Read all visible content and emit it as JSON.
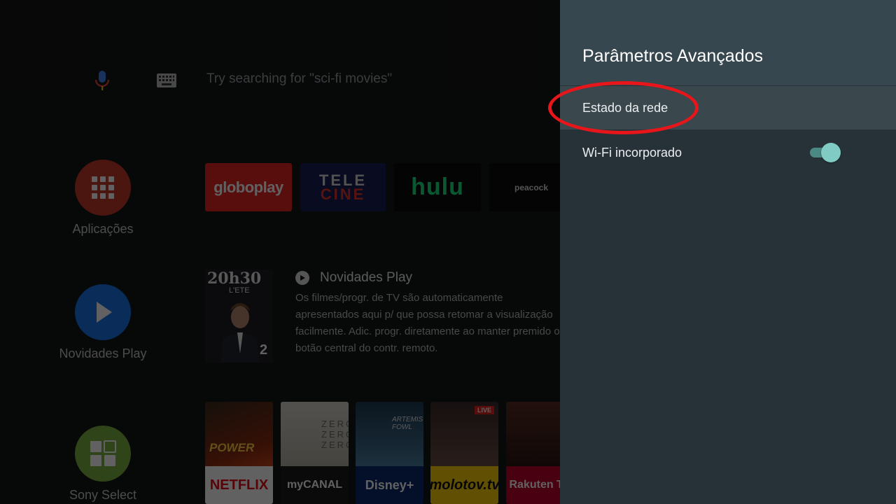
{
  "search": {
    "hint": "Try searching for \"sci-fi movies\"",
    "mic_icon": "mic-icon",
    "keyboard_icon": "keyboard-icon"
  },
  "sidebar": {
    "items": [
      {
        "label": "Aplicações",
        "icon": "apps-grid-icon",
        "color": "#c53a2a"
      },
      {
        "label": "Novidades Play",
        "icon": "play-icon",
        "color": "#1a73e8"
      },
      {
        "label": "Sony Select",
        "icon": "sony-select-icon",
        "color": "#7cb342"
      }
    ]
  },
  "channels": [
    {
      "label": "globoplay",
      "color": "#e42523"
    },
    {
      "label_top": "TELE",
      "label_bottom": "CINE",
      "color": "#1a1d55"
    },
    {
      "label": "hulu",
      "color": "#1ce783"
    },
    {
      "label": "peacock"
    }
  ],
  "recommendation": {
    "thumb_title": "20h30",
    "thumb_subtitle": "L'ETE",
    "thumb_number": "2",
    "title": "Novidades Play",
    "description": "Os filmes/progr. de TV são automaticamente apresentados aqui p/ que possa retomar a visualização facilmente. Adic. progr. diretamente ao manter premido o botão central do contr. remoto."
  },
  "tiles": [
    {
      "art_text": "POWER",
      "brand": "NETFLIX",
      "brand_color": "#e50914"
    },
    {
      "art_text": "ZERO ZERO ZERO",
      "brand": "myCANAL"
    },
    {
      "art_text": "ARTEMIS FOWL",
      "brand": "Disney+"
    },
    {
      "badge": "LIVE",
      "brand": "molotov.tv",
      "brand_color": "#ffd20a"
    },
    {
      "brand": "Rakuten TV",
      "brand_color": "#c0002e"
    }
  ],
  "panel": {
    "title": "Parâmetros Avançados",
    "items": [
      {
        "label": "Estado da rede",
        "selected": true
      },
      {
        "label": "Wi-Fi incorporado",
        "toggle": true
      }
    ],
    "accent": "#80cbc4",
    "highlight_color": "#e8161a"
  }
}
